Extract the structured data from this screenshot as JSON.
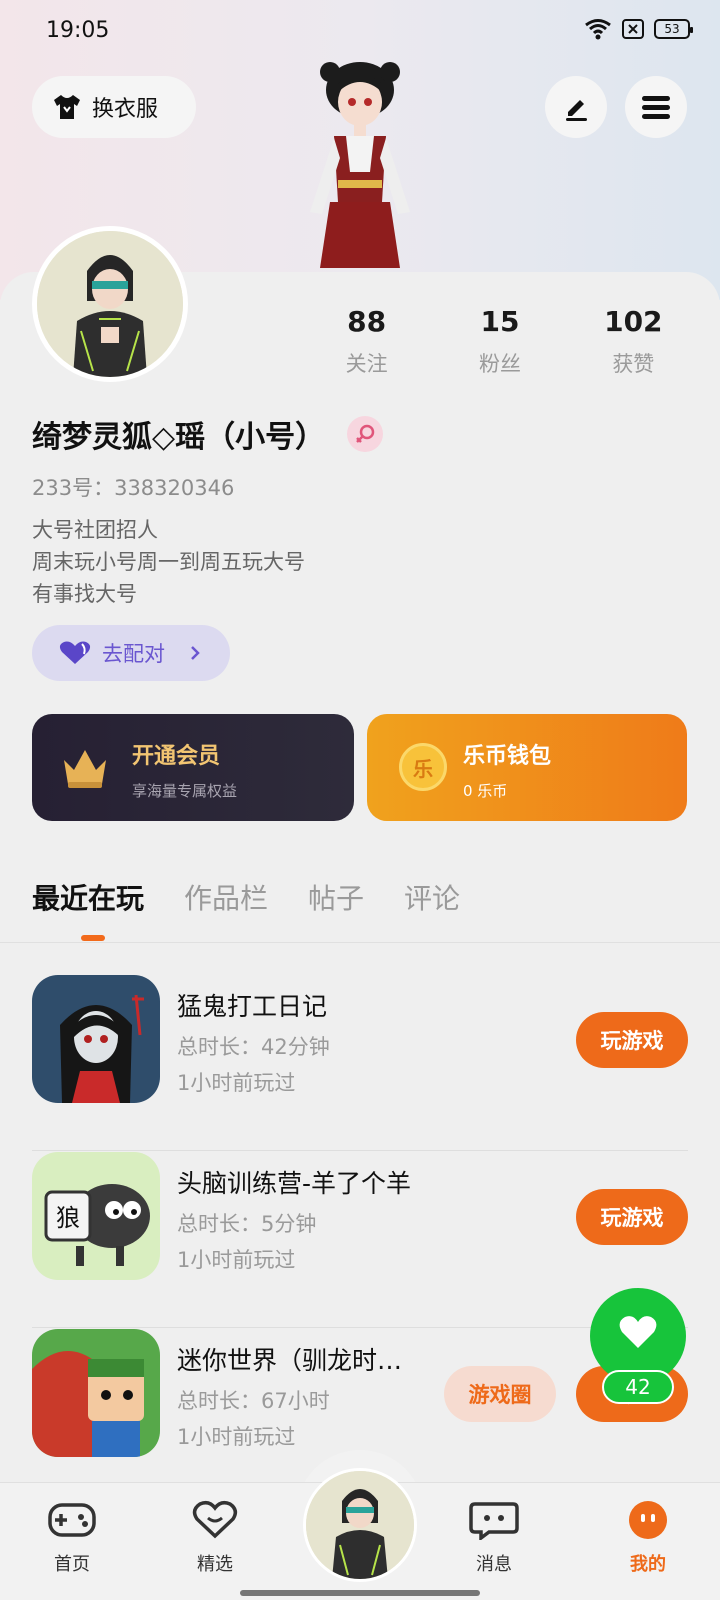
{
  "status_bar": {
    "time": "19:05",
    "battery": "53"
  },
  "header": {
    "outfit_label": "换衣服"
  },
  "profile": {
    "nickname": "绮梦灵狐◇瑶（小号）",
    "uid": "233号：338320346",
    "bio": [
      "大号社团招人",
      "周末玩小号周一到周五玩大号",
      "有事找大号"
    ],
    "stats": [
      {
        "value": "88",
        "label": "关注"
      },
      {
        "value": "15",
        "label": "粉丝"
      },
      {
        "value": "102",
        "label": "获赞"
      }
    ],
    "match_label": "去配对"
  },
  "cards": {
    "vip": {
      "title": "开通会员",
      "subtitle": "享海量专属权益"
    },
    "wallet": {
      "title": "乐币钱包",
      "subtitle": "0 乐币",
      "coin_glyph": "乐"
    }
  },
  "tabs": [
    "最近在玩",
    "作品栏",
    "帖子",
    "评论"
  ],
  "games": [
    {
      "name": "猛鬼打工日记",
      "duration": "总时长：42分钟",
      "last_played": "1小时前玩过",
      "play_label": "玩游戏"
    },
    {
      "name": "头脑训练营-羊了个羊",
      "duration": "总时长：5分钟",
      "last_played": "1小时前玩过",
      "play_label": "玩游戏",
      "icon_text": "狼"
    },
    {
      "name": "迷你世界（驯龙时…",
      "duration": "总时长：67小时",
      "last_played": "1小时前玩过",
      "play_label": "玩",
      "circle_label": "游戏圈"
    }
  ],
  "floating": {
    "count": "42"
  },
  "bottom_nav": [
    {
      "label": "首页"
    },
    {
      "label": "精选"
    },
    {
      "label": "消息"
    },
    {
      "label": "我的"
    }
  ],
  "colors": {
    "accent": "#ee6a1a",
    "match": "#6a56d0",
    "float": "#17c43b"
  }
}
